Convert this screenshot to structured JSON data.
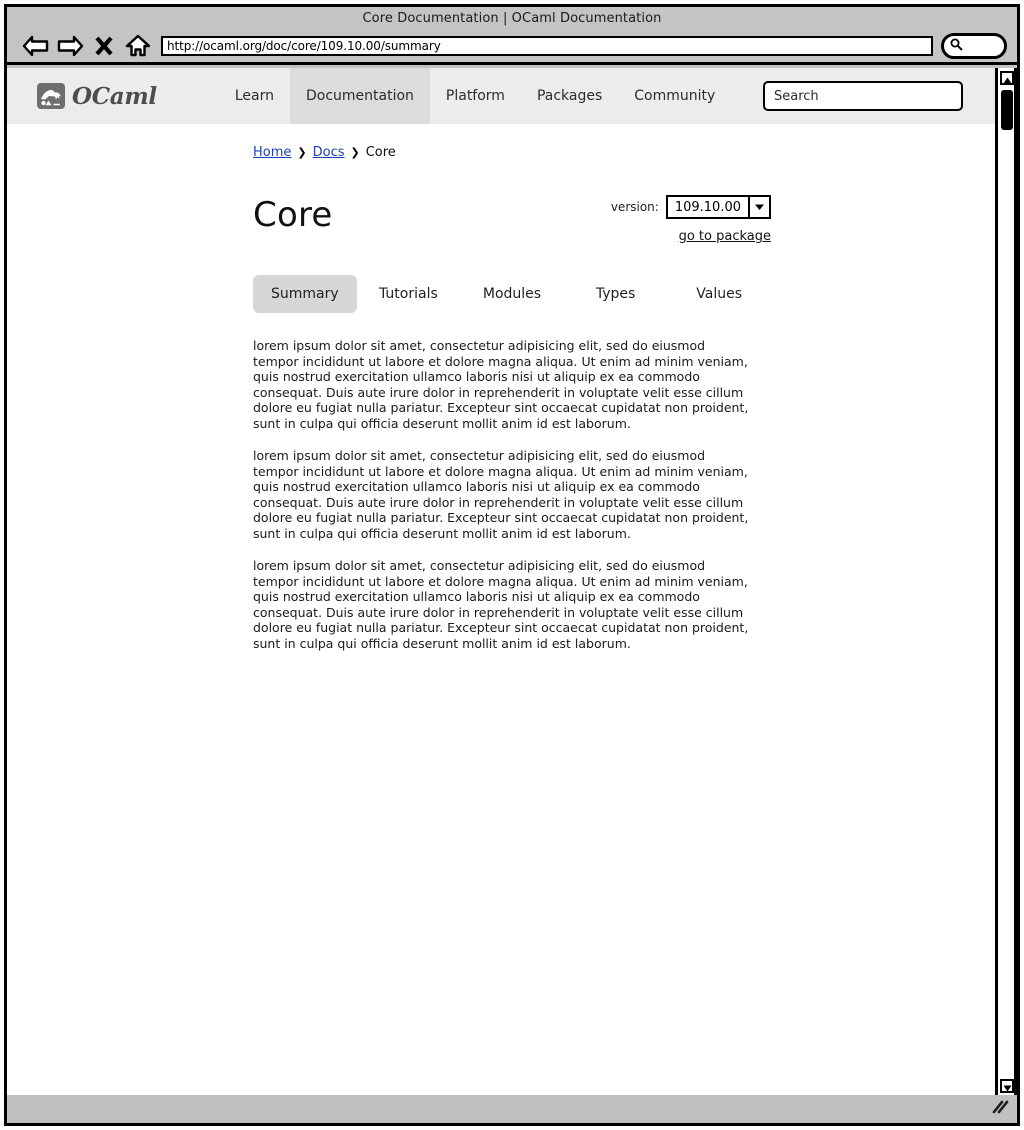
{
  "browser": {
    "window_title": "Core Documentation | OCaml Documentation",
    "url": "http://ocaml.org/doc/core/109.10.00/summary",
    "back_icon": "back-arrow-icon",
    "forward_icon": "forward-arrow-icon",
    "stop_icon": "stop-x-icon",
    "home_icon": "home-icon",
    "toolbar_search_icon": "search-icon"
  },
  "site_header": {
    "brand_name": "OCaml",
    "brand_icon": "camel-logo-icon",
    "nav_items": [
      {
        "label": "Learn",
        "active": false
      },
      {
        "label": "Documentation",
        "active": true
      },
      {
        "label": "Platform",
        "active": false
      },
      {
        "label": "Packages",
        "active": false
      },
      {
        "label": "Community",
        "active": false
      }
    ],
    "search_placeholder": "Search"
  },
  "breadcrumb": {
    "items": [
      {
        "label": "Home",
        "is_link": true
      },
      {
        "label": "Docs",
        "is_link": true
      },
      {
        "label": "Core",
        "is_link": false
      }
    ],
    "separator": "❯"
  },
  "page": {
    "title": "Core",
    "version_label": "version:",
    "version_value": "109.10.00",
    "version_dropdown_icon": "chevron-down-icon",
    "go_to_package_label": "go to package"
  },
  "tabs": [
    {
      "label": "Summary",
      "active": true
    },
    {
      "label": "Tutorials",
      "active": false
    },
    {
      "label": "Modules",
      "active": false
    },
    {
      "label": "Types",
      "active": false
    },
    {
      "label": "Values",
      "active": false
    }
  ],
  "content": {
    "paragraphs": [
      "lorem ipsum dolor sit amet, consectetur adipisicing elit, sed do eiusmod tempor incididunt ut labore et dolore magna aliqua. Ut enim ad minim veniam, quis nostrud exercitation ullamco laboris nisi ut aliquip ex ea commodo consequat. Duis aute irure dolor in reprehenderit in voluptate velit esse cillum dolore eu fugiat nulla pariatur. Excepteur sint occaecat cupidatat non proident, sunt in culpa qui officia deserunt mollit anim id est laborum.",
      "lorem ipsum dolor sit amet, consectetur adipisicing elit, sed do eiusmod tempor incididunt ut labore et dolore magna aliqua. Ut enim ad minim veniam, quis nostrud exercitation ullamco laboris nisi ut aliquip ex ea commodo consequat. Duis aute irure dolor in reprehenderit in voluptate velit esse cillum dolore eu fugiat nulla pariatur. Excepteur sint occaecat cupidatat non proident, sunt in culpa qui officia deserunt mollit anim id est laborum.",
      "lorem ipsum dolor sit amet, consectetur adipisicing elit, sed do eiusmod tempor incididunt ut labore et dolore magna aliqua. Ut enim ad minim veniam, quis nostrud exercitation ullamco laboris nisi ut aliquip ex ea commodo consequat. Duis aute irure dolor in reprehenderit in voluptate velit esse cillum dolore eu fugiat nulla pariatur. Excepteur sint occaecat cupidatat non proident, sunt in culpa qui officia deserunt mollit anim id est laborum."
    ]
  },
  "scrollbar": {
    "up_icon": "scroll-up-arrow-icon",
    "down_icon": "scroll-down-arrow-icon"
  },
  "status_bar": {
    "resize_grip_icon": "resize-grip-icon"
  },
  "colors": {
    "window_chrome": "#c4c4c4",
    "header_bg": "#ececec",
    "nav_active_bg": "#dcdcdc",
    "tab_active_bg": "#d6d6d6",
    "link": "#1d3fb3",
    "brand_gray": "#6e6e6e"
  }
}
